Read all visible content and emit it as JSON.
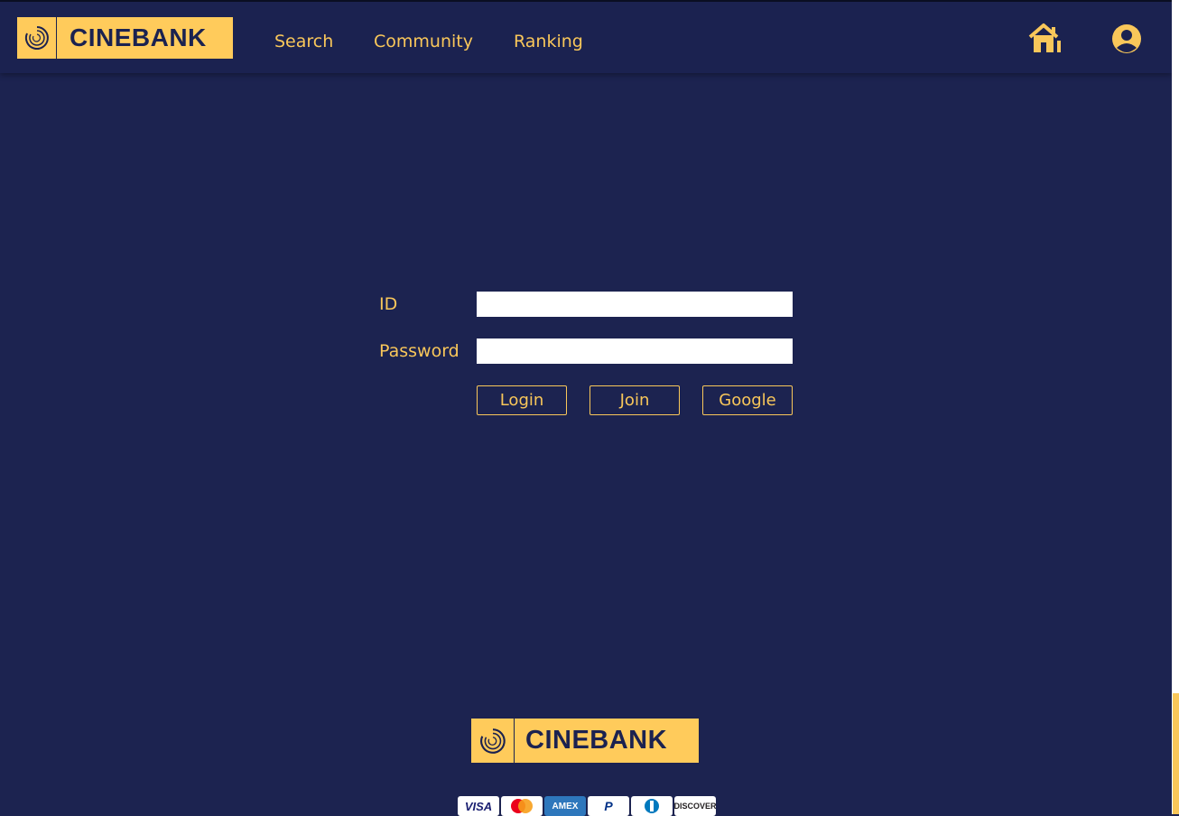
{
  "brand": {
    "name": "CINEBANK"
  },
  "nav": {
    "links": [
      "Search",
      "Community",
      "Ranking"
    ]
  },
  "header_icons": [
    "home-icon",
    "user-account-icon"
  ],
  "login": {
    "id_label": "ID",
    "id_value": "",
    "password_label": "Password",
    "password_value": "",
    "buttons": {
      "login": "Login",
      "join": "Join",
      "google": "Google"
    }
  },
  "footer": {
    "brand": "CINEBANK",
    "payment_methods": [
      "VISA",
      "Mastercard",
      "AMEX",
      "PayPal",
      "Diners Club",
      "DISCOVER"
    ]
  },
  "colors": {
    "background": "#1c2350",
    "accent": "#f9c75a",
    "logo_bg": "#ffcb5b"
  }
}
